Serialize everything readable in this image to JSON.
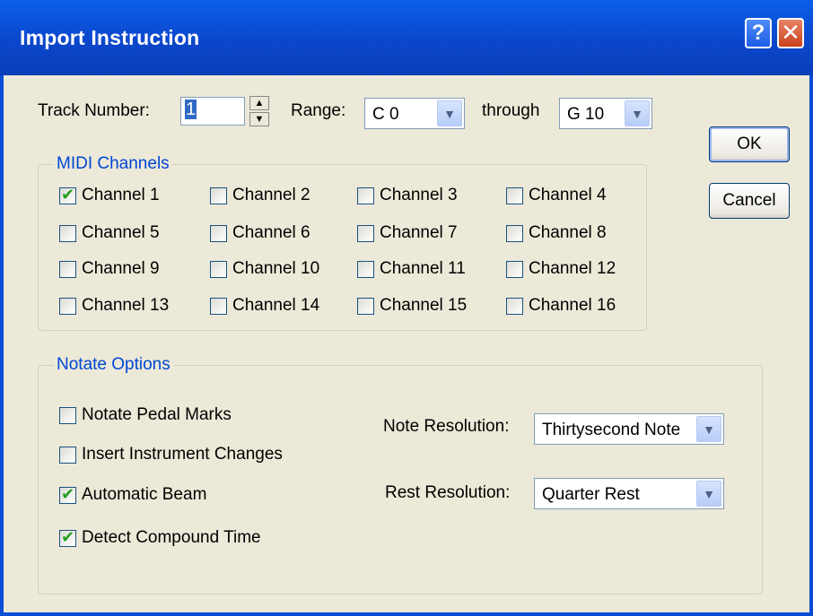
{
  "window": {
    "title": "Import Instruction",
    "help_glyph": "?",
    "close_glyph": "✕"
  },
  "track": {
    "label": "Track Number:",
    "value": "1"
  },
  "range": {
    "label": "Range:",
    "from": "C 0",
    "through_label": "through",
    "to": "G 10"
  },
  "buttons": {
    "ok": "OK",
    "cancel": "Cancel"
  },
  "midi_channels": {
    "title": "MIDI Channels",
    "channels": [
      {
        "label": "Channel 1",
        "checked": true
      },
      {
        "label": "Channel 2",
        "checked": false
      },
      {
        "label": "Channel 3",
        "checked": false
      },
      {
        "label": "Channel 4",
        "checked": false
      },
      {
        "label": "Channel 5",
        "checked": false
      },
      {
        "label": "Channel 6",
        "checked": false
      },
      {
        "label": "Channel 7",
        "checked": false
      },
      {
        "label": "Channel 8",
        "checked": false
      },
      {
        "label": "Channel 9",
        "checked": false
      },
      {
        "label": "Channel 10",
        "checked": false
      },
      {
        "label": "Channel 11",
        "checked": false
      },
      {
        "label": "Channel 12",
        "checked": false
      },
      {
        "label": "Channel 13",
        "checked": false
      },
      {
        "label": "Channel 14",
        "checked": false
      },
      {
        "label": "Channel 15",
        "checked": false
      },
      {
        "label": "Channel 16",
        "checked": false
      }
    ]
  },
  "notate_options": {
    "title": "Notate Options",
    "options": [
      {
        "label": "Notate Pedal Marks",
        "checked": false
      },
      {
        "label": "Insert Instrument Changes",
        "checked": false
      },
      {
        "label": "Automatic Beam",
        "checked": true
      },
      {
        "label": "Detect Compound Time",
        "checked": true
      }
    ],
    "note_resolution": {
      "label": "Note Resolution:",
      "value": "Thirtysecond Note"
    },
    "rest_resolution": {
      "label": "Rest Resolution:",
      "value": "Quarter Rest"
    }
  },
  "icons": {
    "check_glyph": "✔",
    "dropdown_glyph": "▼"
  },
  "colors": {
    "title_bar": "#0a4ed6",
    "group_title": "#0046d5",
    "check": "#21a121"
  }
}
